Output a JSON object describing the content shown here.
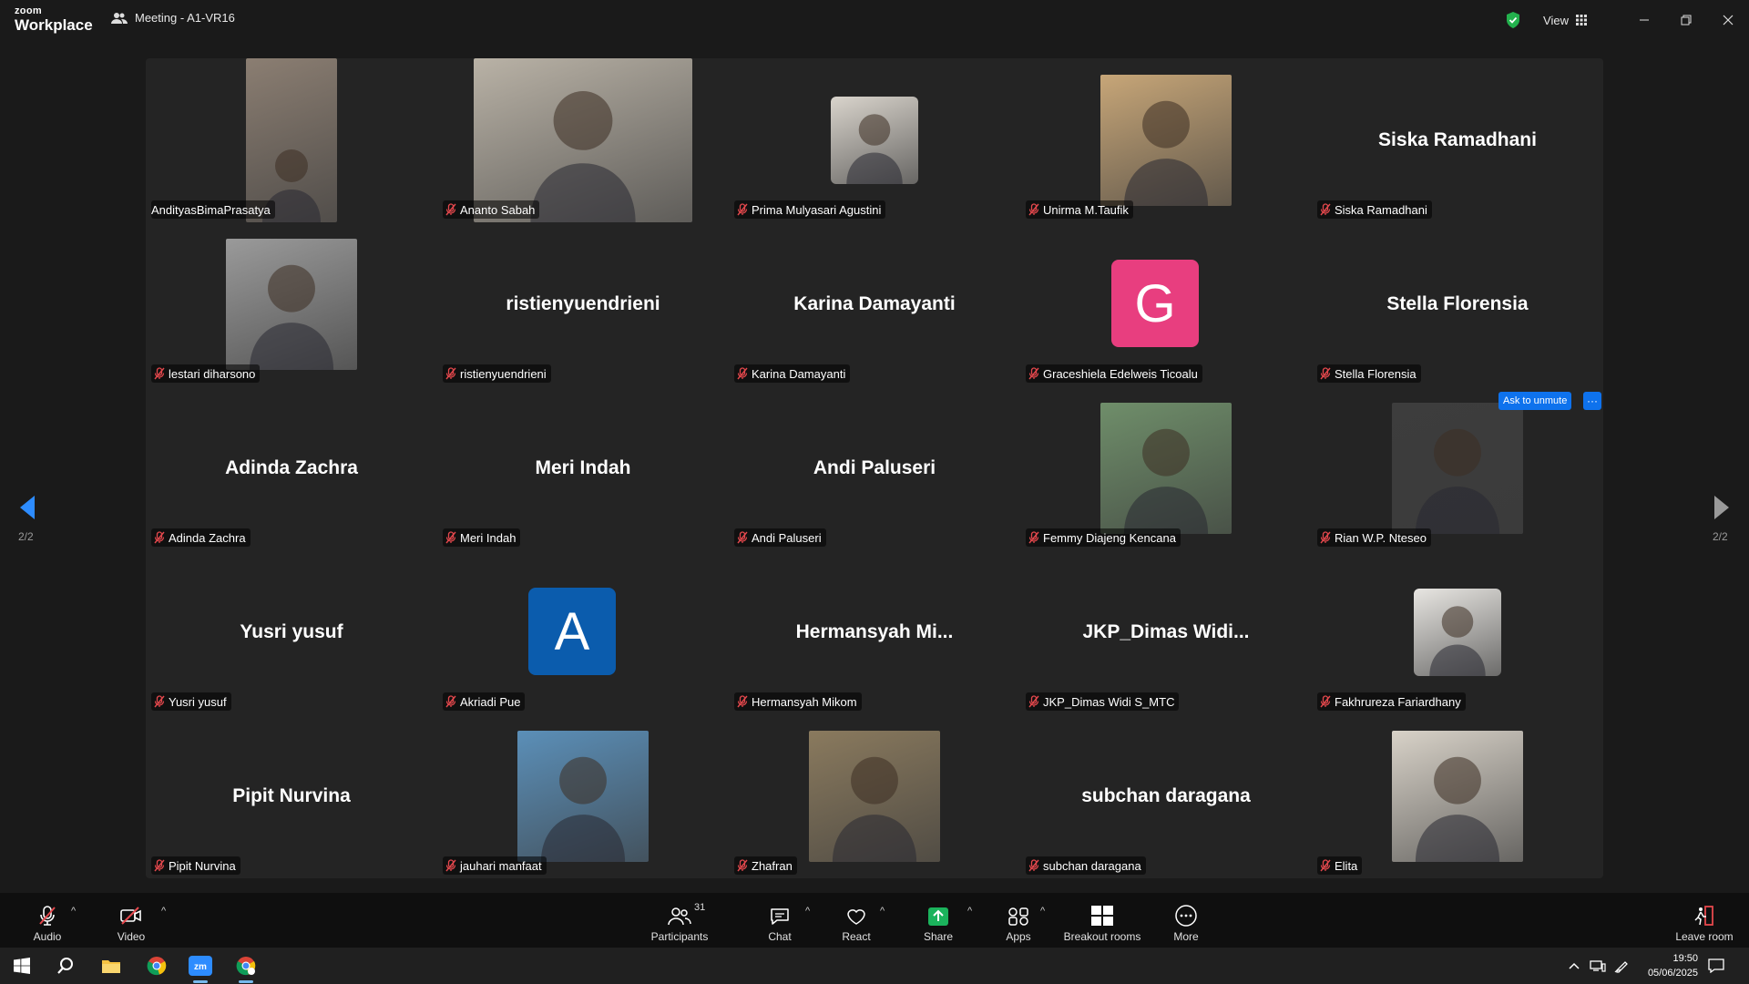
{
  "titlebar": {
    "logo_top": "zoom",
    "logo_bottom": "Workplace",
    "meeting_title": "Meeting - A1-VR16",
    "view_label": "View"
  },
  "participants": [
    {
      "name": "AndityasBimaPrasatya",
      "display": "",
      "muted": false,
      "kind": "video",
      "video_color": "#8b7e72"
    },
    {
      "name": "Ananto Sabah",
      "display": "",
      "muted": true,
      "kind": "video",
      "video_color": "#b9b2a6"
    },
    {
      "name": "Prima Mulyasari Agustini",
      "display": "",
      "muted": true,
      "kind": "photo",
      "video_color": "#d9d4cc"
    },
    {
      "name": "Unirma M.Taufik",
      "display": "",
      "muted": true,
      "kind": "photo",
      "video_color": "#c7a678"
    },
    {
      "name": "Siska Ramadhani",
      "display": "Siska Ramadhani",
      "muted": true,
      "kind": "name"
    },
    {
      "name": "lestari diharsono",
      "display": "",
      "muted": true,
      "kind": "photo",
      "video_color": "#9a9a9a"
    },
    {
      "name": "ristienyuendrieni",
      "display": "ristienyuendrieni",
      "muted": true,
      "kind": "name"
    },
    {
      "name": "Karina Damayanti",
      "display": "Karina Damayanti",
      "muted": true,
      "kind": "name"
    },
    {
      "name": "Graceshiela Edelweis Ticoalu",
      "display": "G",
      "muted": true,
      "kind": "initial",
      "bg": "#e83e7f"
    },
    {
      "name": "Stella Florensia",
      "display": "Stella Florensia",
      "muted": true,
      "kind": "name"
    },
    {
      "name": "Adinda Zachra",
      "display": "Adinda Zachra",
      "muted": true,
      "kind": "name"
    },
    {
      "name": "Meri Indah",
      "display": "Meri Indah",
      "muted": true,
      "kind": "name"
    },
    {
      "name": "Andi Paluseri",
      "display": "Andi Paluseri",
      "muted": true,
      "kind": "name"
    },
    {
      "name": "Femmy Diajeng Kencana",
      "display": "",
      "muted": true,
      "kind": "photo",
      "video_color": "#6f8e6a"
    },
    {
      "name": "Rian W.P. Nteseo",
      "display": "",
      "muted": true,
      "kind": "photo",
      "video_color": "#3d3d3d"
    },
    {
      "name": "Yusri yusuf",
      "display": "Yusri yusuf",
      "muted": true,
      "kind": "name"
    },
    {
      "name": "Akriadi Pue",
      "display": "A",
      "muted": true,
      "kind": "initial",
      "bg": "#0b5cad"
    },
    {
      "name": "Hermansyah Mikom",
      "display": "Hermansyah  Mi...",
      "muted": true,
      "kind": "name"
    },
    {
      "name": "JKP_Dimas Widi S_MTC",
      "display": "JKP_Dimas  Widi...",
      "muted": true,
      "kind": "name"
    },
    {
      "name": "Fakhrureza Fariardhany",
      "display": "",
      "muted": true,
      "kind": "photo",
      "video_color": "#e8e6e2"
    },
    {
      "name": "Pipit Nurvina",
      "display": "Pipit Nurvina",
      "muted": true,
      "kind": "name"
    },
    {
      "name": "jauhari manfaat",
      "display": "",
      "muted": true,
      "kind": "photo",
      "video_color": "#5b8fb8"
    },
    {
      "name": "Zhafran",
      "display": "",
      "muted": true,
      "kind": "photo",
      "video_color": "#8a7a5e"
    },
    {
      "name": "subchan daragana",
      "display": "subchan daragana",
      "muted": true,
      "kind": "name"
    },
    {
      "name": "Elita",
      "display": "",
      "muted": true,
      "kind": "photo",
      "video_color": "#d8d2c8"
    }
  ],
  "popup": {
    "ask_unmute": "Ask to unmute",
    "more": "···"
  },
  "pagination": {
    "left": "2/2",
    "right": "2/2"
  },
  "toolbar": {
    "audio": "Audio",
    "video": "Video",
    "participants": "Participants",
    "participants_count": "31",
    "chat": "Chat",
    "react": "React",
    "share": "Share",
    "apps": "Apps",
    "breakout": "Breakout rooms",
    "more": "More",
    "leave": "Leave room"
  },
  "taskbar": {
    "time": "19:50",
    "date": "05/06/2025"
  },
  "colors": {
    "accent": "#0e72ed",
    "mute_red": "#e5484d",
    "share_green": "#1bb35c"
  }
}
